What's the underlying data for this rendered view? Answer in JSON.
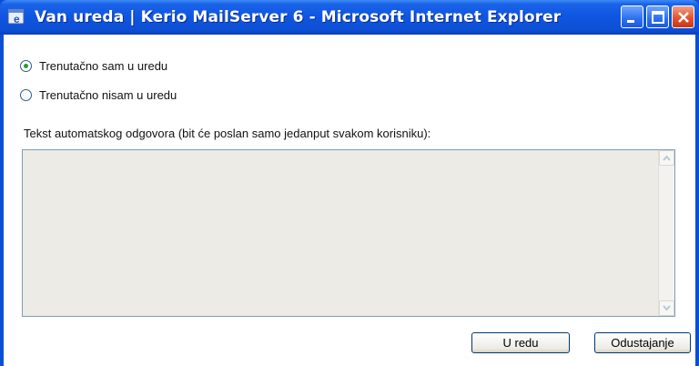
{
  "window": {
    "title": "Van ureda | Kerio MailServer 6 - Microsoft Internet Explorer"
  },
  "icons": {
    "app": "ie-icon",
    "minimize": "minimize-icon",
    "maximize": "maximize-icon",
    "close": "close-icon"
  },
  "form": {
    "radio_in_office": "Trenutačno sam u uredu",
    "radio_out_of_office": "Trenutačno nisam u uredu",
    "selected": "radio_in_office",
    "reply_label": "Tekst automatskog odgovora (bit će poslan samo jedanput svakom korisniku):",
    "reply_text": ""
  },
  "buttons": {
    "ok": "U redu",
    "cancel": "Odustajanje"
  }
}
